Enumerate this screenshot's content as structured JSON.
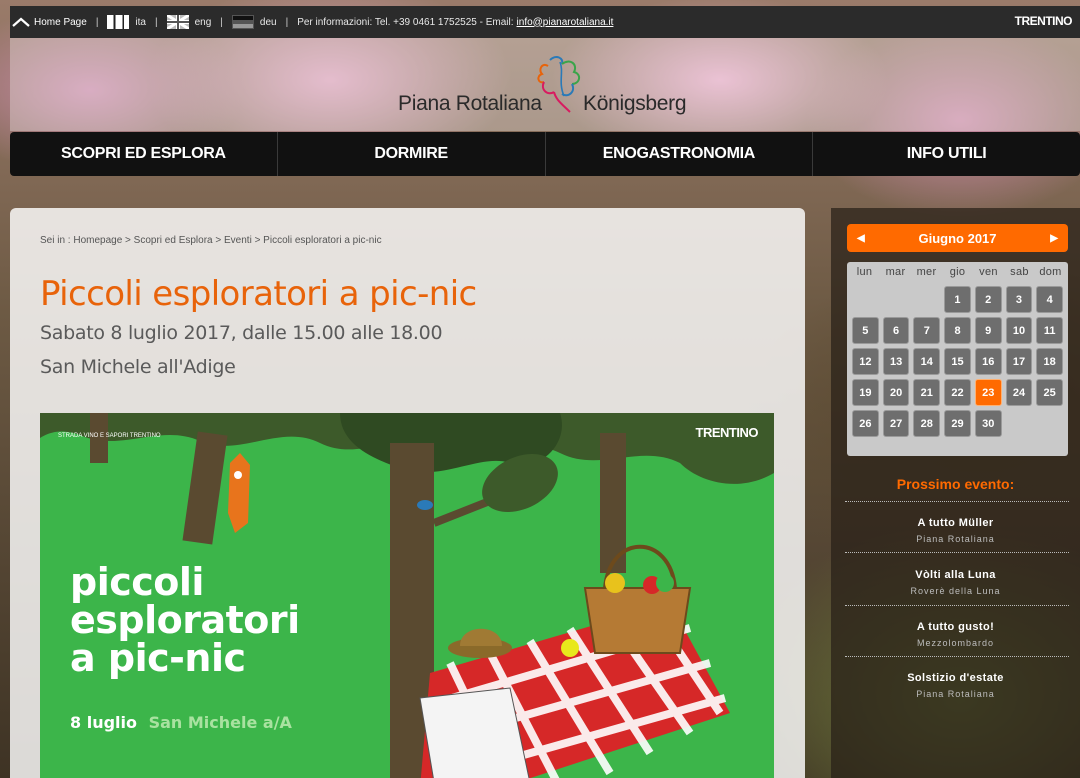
{
  "topbar": {
    "home_label": "Home Page",
    "sep": "|",
    "lang_it": "ita",
    "lang_en": "eng",
    "lang_de": "deu",
    "info": "Per informazioni: Tel. +39 0461 1752525 - Email:",
    "email": "info@pianarotaliana.it",
    "brand": "TRENTINO"
  },
  "header": {
    "logo_left": "Piana Rotaliana",
    "logo_right": "Königsberg"
  },
  "nav": {
    "items": [
      "SCOPRI ED ESPLORA",
      "DORMIRE",
      "ENOGASTRONOMIA",
      "INFO UTILI"
    ]
  },
  "main": {
    "breadcrumb": "Sei in  : Homepage > Scopri ed Esplora > Eventi > Piccoli esploratori a pic-nic",
    "title": "Piccoli esploratori a pic-nic",
    "date_line": "Sabato 8 luglio 2017, dalle 15.00 alle 18.00",
    "place_line": "San Michele all'Adige",
    "poster": {
      "brand": "TRENTINO",
      "strada": "STRADA VINO E SAPORI TRENTINO",
      "title_l1": "piccoli",
      "title_l2": "esploratori",
      "title_l3": "a pic-nic",
      "date": "8 luglio",
      "place": "San Michele a/A"
    }
  },
  "calendar": {
    "month": "Giugno 2017",
    "prev_icon": "triangle-left-icon",
    "next_icon": "triangle-right-icon",
    "days_of_week": [
      "lun",
      "mar",
      "mer",
      "gio",
      "ven",
      "sab",
      "dom"
    ],
    "weeks": [
      [
        "",
        "",
        "",
        "1",
        "2",
        "3",
        "4"
      ],
      [
        "5",
        "6",
        "7",
        "8",
        "9",
        "10",
        "11"
      ],
      [
        "12",
        "13",
        "14",
        "15",
        "16",
        "17",
        "18"
      ],
      [
        "19",
        "20",
        "21",
        "22",
        "23",
        "24",
        "25"
      ],
      [
        "26",
        "27",
        "28",
        "29",
        "30",
        "",
        ""
      ]
    ],
    "today": "23",
    "accent_color": "#ff6a00"
  },
  "next_events": {
    "title": "Prossimo evento:",
    "items": [
      {
        "name": "A tutto Müller",
        "place": "Piana Rotaliana"
      },
      {
        "name": "Vòlti alla Luna",
        "place": "Roverè della Luna"
      },
      {
        "name": "A tutto gusto!",
        "place": "Mezzolombardo"
      },
      {
        "name": "Solstizio d'estate",
        "place": "Piana Rotaliana"
      }
    ]
  }
}
